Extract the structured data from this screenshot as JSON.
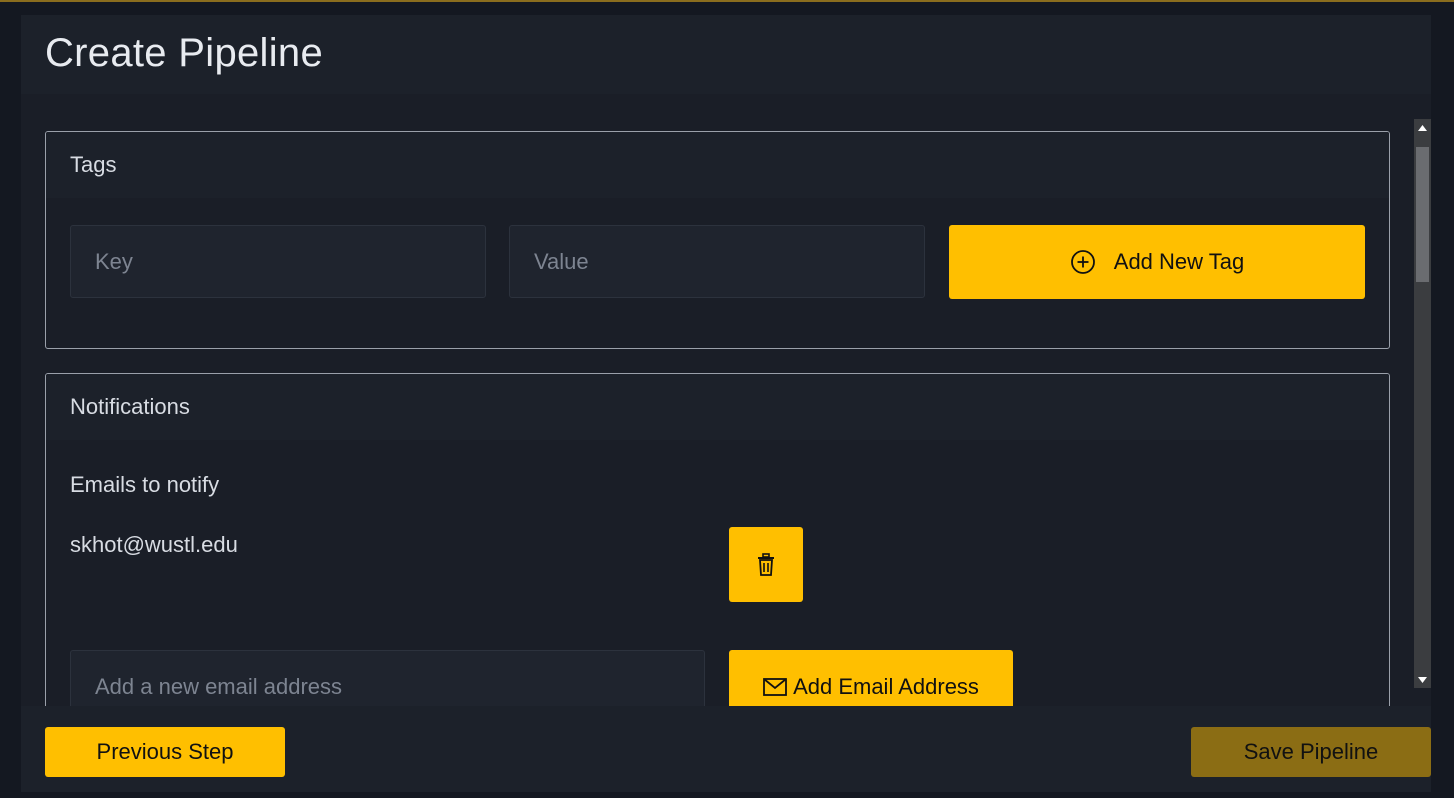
{
  "modal": {
    "title": "Create Pipeline"
  },
  "tags": {
    "title": "Tags",
    "key_placeholder": "Key",
    "value_placeholder": "Value",
    "add_label": "Add New Tag"
  },
  "notifications": {
    "title": "Notifications",
    "emails_label": "Emails to notify",
    "emails": [
      "skhot@wustl.edu"
    ],
    "email_placeholder": "Add a new email address",
    "add_email_label": "Add Email Address"
  },
  "footer": {
    "previous_label": "Previous Step",
    "save_label": "Save Pipeline"
  },
  "colors": {
    "accent": "#ffbf00",
    "accent_disabled": "#8b6d14",
    "background": "#1a1e27"
  },
  "icons": {
    "add_tag": "plus-circle-icon",
    "delete_email": "trash-icon",
    "add_email": "envelope-icon"
  }
}
